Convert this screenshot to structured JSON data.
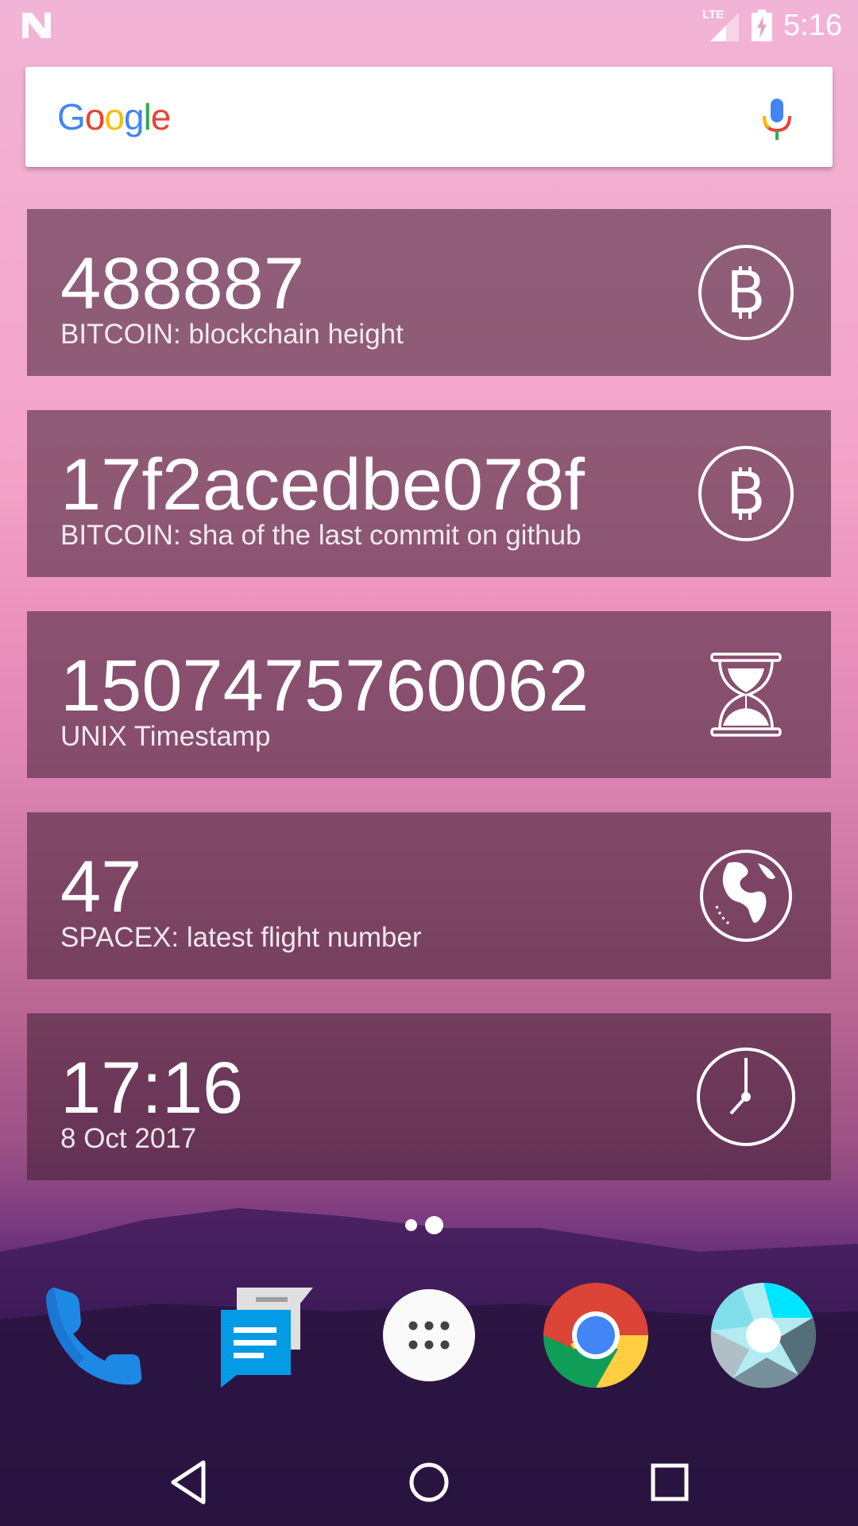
{
  "status_bar": {
    "time": "5:16",
    "network_label": "LTE",
    "icons": [
      "notification-n-icon",
      "lte-signal-icon",
      "battery-charging-icon"
    ]
  },
  "search": {
    "logo_text": "Google",
    "logo_colors": [
      "#4285F4",
      "#EA4335",
      "#FBBC05",
      "#4285F4",
      "#34A853",
      "#EA4335"
    ],
    "icon": "mic-icon"
  },
  "widgets": [
    {
      "value": "488887",
      "label": "BITCOIN: blockchain height",
      "icon": "bitcoin-icon"
    },
    {
      "value": "17f2acedbe078f",
      "label": "BITCOIN: sha of the last commit on github",
      "icon": "bitcoin-icon"
    },
    {
      "value": "1507475760062",
      "label": "UNIX Timestamp",
      "icon": "hourglass-icon"
    },
    {
      "value": "47",
      "label": "SPACEX: latest flight number",
      "icon": "globe-icon"
    },
    {
      "value": "17:16",
      "label": "8 Oct 2017",
      "icon": "clock-icon"
    }
  ],
  "page_indicator": {
    "pages": 2,
    "current": 2
  },
  "dock": [
    "phone-icon",
    "messages-icon",
    "app-drawer-icon",
    "chrome-icon",
    "camera-icon"
  ],
  "nav_bar": [
    "back-icon",
    "home-icon",
    "recents-icon"
  ],
  "colors": {
    "widget_bg": "rgba(60,30,50,0.55)",
    "phone_blue": "#1E88E5",
    "messages_blue": "#039BE5"
  }
}
